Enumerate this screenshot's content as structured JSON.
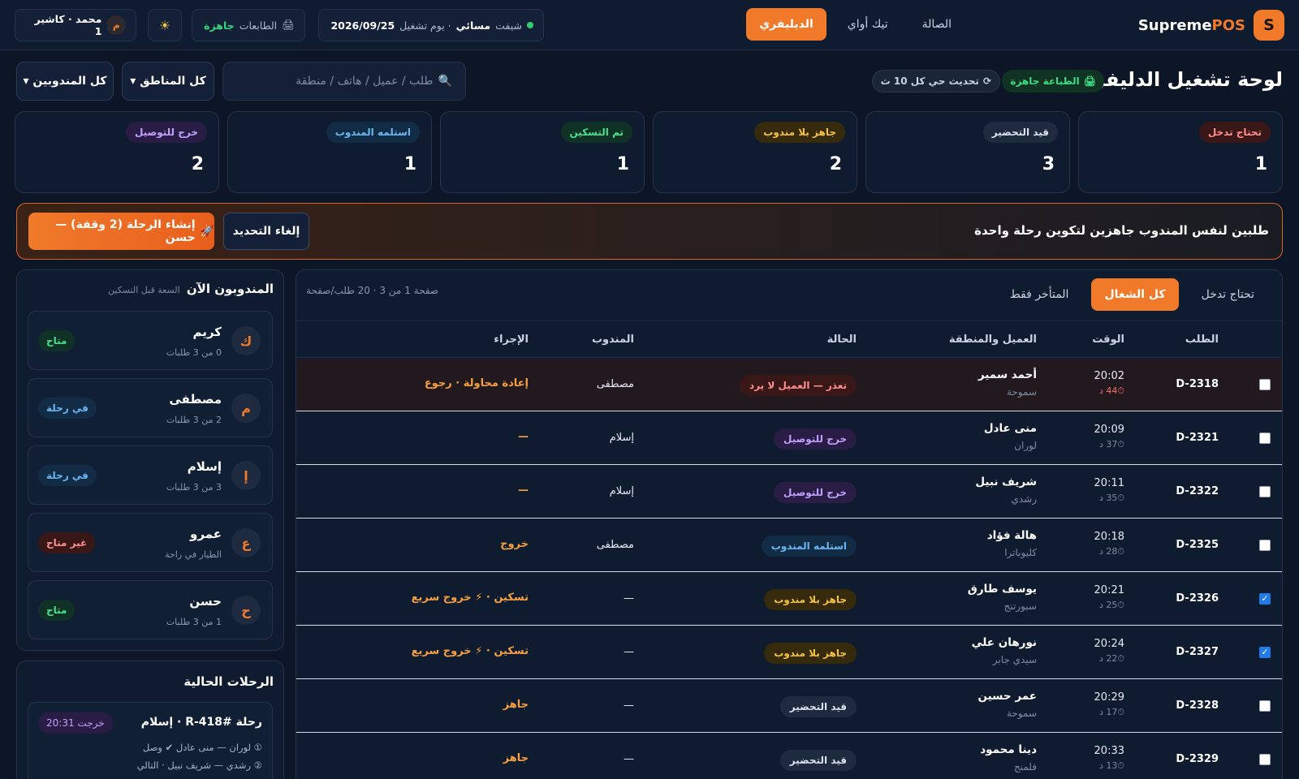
{
  "topbar": {
    "brand_logo": "S",
    "brand_main": "Supreme",
    "brand_accent": "POS",
    "tabs": [
      {
        "label": "الصالة"
      },
      {
        "label": "تيك أواي"
      },
      {
        "label": "الديليفري"
      }
    ],
    "shift_label": "شيفت",
    "shift_value": "مسائي",
    "shift_day": "· يوم تشغيل",
    "shift_date": "2026/09/25",
    "printer_label": "الطابعات",
    "printer_value": "جاهزة",
    "printer_icon": "🖨",
    "theme_icon": "☀",
    "user_initial": "م",
    "user_label": "محمد · كاشير 1"
  },
  "header": {
    "title": "لوحة تشغيل الدليفري",
    "print_ready": "الطباعة جاهزة",
    "refresh": "تحديث حي كل 10 ث",
    "refresh_icon": "⟳",
    "search_icon": "🔍",
    "search_placeholder": "طلب / عميل / هاتف / منطقة",
    "filter_zones": "كل المناطق ▾",
    "filter_drivers": "كل المندوبين ▾"
  },
  "stats": [
    {
      "label": "تحتاج تدخل",
      "count": "1"
    },
    {
      "label": "قيد التحضير",
      "count": "3"
    },
    {
      "label": "جاهز بلا مندوب",
      "count": "2"
    },
    {
      "label": "تم التسكين",
      "count": "1"
    },
    {
      "label": "استلمه المندوب",
      "count": "1"
    },
    {
      "label": "خرج للتوصيل",
      "count": "2"
    }
  ],
  "banner": {
    "text": "طلبين لنفس المندوب جاهزين لتكوين رحلة واحدة",
    "cancel": "إلغاء التحديد",
    "create": "إنشاء الرحلة (2 وقفة) — حسن",
    "create_icon": "🚀"
  },
  "orders": {
    "tabs": [
      {
        "label": "تحتاج تدخل"
      },
      {
        "label": "كل الشغال"
      },
      {
        "label": "المتأخر فقط"
      }
    ],
    "page_info": "صفحة 1 من 3 · 20 طلب/صفحة",
    "headers": {
      "order": "الطلب",
      "time": "الوقت",
      "customer": "العميل والمنطقة",
      "status": "الحالة",
      "driver": "المندوب",
      "action": "الإجراء"
    },
    "rows": [
      {
        "id": "D-2318",
        "time": "20:02",
        "age": "⏱44 د",
        "name": "أحمد سمير",
        "zone": "سموحة",
        "status": "تعذر — العميل لا يرد",
        "driver": "مصطفى",
        "action": "إعادة محاولة · رجوع",
        "checked": false
      },
      {
        "id": "D-2321",
        "time": "20:09",
        "age": "⏱37 د",
        "name": "منى عادل",
        "zone": "لوران",
        "status": "خرج للتوصيل",
        "driver": "إسلام",
        "action": "—",
        "checked": false
      },
      {
        "id": "D-2322",
        "time": "20:11",
        "age": "⏱35 د",
        "name": "شريف نبيل",
        "zone": "رشدي",
        "status": "خرج للتوصيل",
        "driver": "إسلام",
        "action": "—",
        "checked": false
      },
      {
        "id": "D-2325",
        "time": "20:18",
        "age": "⏱28 د",
        "name": "هالة فؤاد",
        "zone": "كليوباترا",
        "status": "استلمه المندوب",
        "driver": "مصطفى",
        "action": "خروج",
        "checked": false
      },
      {
        "id": "D-2326",
        "time": "20:21",
        "age": "⏱25 د",
        "name": "يوسف طارق",
        "zone": "سبورتنج",
        "status": "جاهز بلا مندوب",
        "driver": "—",
        "action": "تسكين · ⚡ خروج سريع",
        "checked": true
      },
      {
        "id": "D-2327",
        "time": "20:24",
        "age": "⏱22 د",
        "name": "نورهان علي",
        "zone": "سيدي جابر",
        "status": "جاهز بلا مندوب",
        "driver": "—",
        "action": "تسكين · ⚡ خروج سريع",
        "checked": true
      },
      {
        "id": "D-2328",
        "time": "20:29",
        "age": "⏱17 د",
        "name": "عمر حسين",
        "zone": "سموحة",
        "status": "قيد التحضير",
        "driver": "—",
        "action": "جاهز",
        "checked": false
      },
      {
        "id": "D-2329",
        "time": "20:33",
        "age": "⏱13 د",
        "name": "دينا محمود",
        "zone": "فلمنج",
        "status": "قيد التحضير",
        "driver": "—",
        "action": "جاهز",
        "checked": false
      }
    ]
  },
  "drivers": {
    "title": "المندوبون الآن",
    "subtitle": "السعة قبل التسكين",
    "items": [
      {
        "initial": "ك",
        "name": "كريم",
        "load": "0 من 3 طلبات",
        "status": "متاح"
      },
      {
        "initial": "م",
        "name": "مصطفى",
        "load": "2 من 3 طلبات",
        "status": "في رحلة"
      },
      {
        "initial": "إ",
        "name": "إسلام",
        "load": "3 من 3 طلبات",
        "status": "في رحلة"
      },
      {
        "initial": "ع",
        "name": "عمرو",
        "load": "الطيار في راحة",
        "status": "غير متاح"
      },
      {
        "initial": "ح",
        "name": "حسن",
        "load": "1 من 3 طلبات",
        "status": "متاح"
      }
    ]
  },
  "trips": {
    "title": "الرحلات الحالية",
    "trip_head": "رحلة R-418# · إسلام",
    "trip_badge": "خرجت 20:31",
    "stops": [
      "① لوران — منى عادل ✔ وصل",
      "② رشدي — شريف نبيل · التالي"
    ]
  },
  "colors": {
    "accent": "#f07a2a",
    "background": "#0d1626",
    "panel": "#0f1b2e",
    "status_red": "#ff8f8f",
    "status_gold": "#f5c242",
    "status_green": "#48e08c",
    "status_blue": "#6ab7f5",
    "status_purple": "#c2a0ff"
  }
}
